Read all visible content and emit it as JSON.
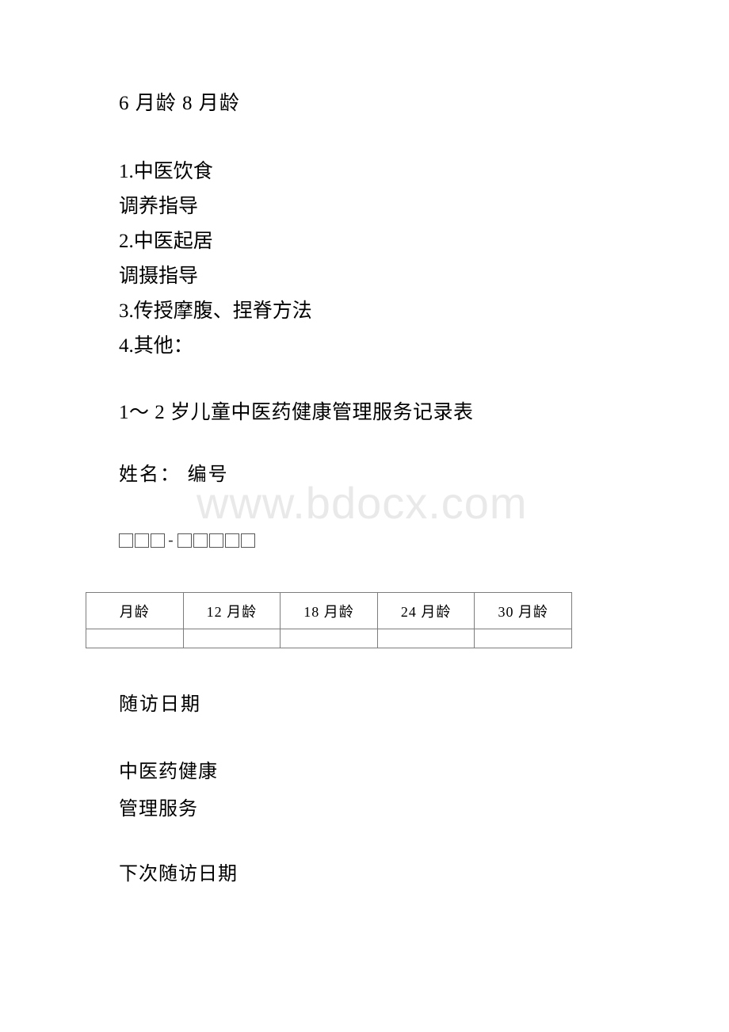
{
  "document": {
    "watermark": "www.bdocx.com",
    "months_line": "6 月龄 8 月龄",
    "guidance_items": [
      "1.中医饮食",
      "调养指导",
      "2.中医起居",
      "调摄指导",
      "3.传授摩腹、捏脊方法",
      "4.其他："
    ],
    "section_title": "1～ 2 岁儿童中医药健康管理服务记录表",
    "name_id_label": "姓名： 编号",
    "id_boxes": {
      "prefix_count": 3,
      "separator": "-",
      "suffix_count": 5
    },
    "table": {
      "headers": [
        "月龄",
        "12 月龄",
        "18 月龄",
        "24 月龄",
        "30 月龄"
      ],
      "rows": [
        [
          "",
          "",
          "",
          "",
          ""
        ]
      ]
    },
    "followup_date_label": "随访日期",
    "service_label_line1": "中医药健康",
    "service_label_line2": "管理服务",
    "next_followup_label": "下次随访日期"
  }
}
